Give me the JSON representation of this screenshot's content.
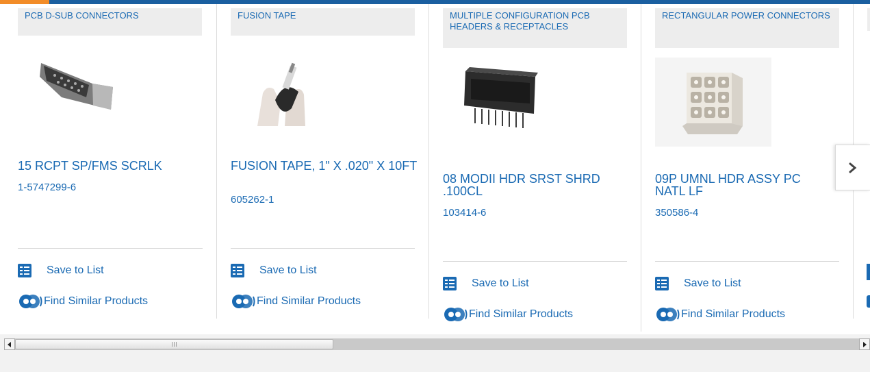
{
  "colors": {
    "brand_blue": "#1a6ab3",
    "accent_orange": "#f28c28",
    "category_bg": "#ededed"
  },
  "cards": [
    {
      "category": "PCB D-SUB CONNECTORS",
      "name": "15 RCPT SP/FMS SCRLK",
      "part": "1-5747299-6",
      "save_label": "Save to List",
      "similar_label": "Find Similar Products",
      "image_icon": "d-sub-connector"
    },
    {
      "category": "FUSION TAPE",
      "name": "FUSION TAPE, 1\" X .020\" X 10FT",
      "part": "605262-1",
      "save_label": "Save to List",
      "similar_label": "Find Similar Products",
      "image_icon": "fusion-tape-hands"
    },
    {
      "category": "MULTIPLE CONFIGURATION PCB HEADERS & RECEPTACLES",
      "name": "08 MODII HDR SRST SHRD .100CL",
      "part": "103414-6",
      "save_label": "Save to List",
      "similar_label": "Find Similar Products",
      "image_icon": "pcb-header"
    },
    {
      "category": "RECTANGULAR POWER CONNECTORS",
      "name": "09P UMNL HDR ASSY PC NATL LF",
      "part": "350586-4",
      "save_label": "Save to List",
      "similar_label": "Find Similar Products",
      "image_icon": "rectangular-power-connector"
    }
  ],
  "carousel": {
    "next_icon": "chevron-right-icon"
  },
  "scrollbar": {
    "left_icon": "arrow-left-icon",
    "right_icon": "arrow-right-icon"
  }
}
